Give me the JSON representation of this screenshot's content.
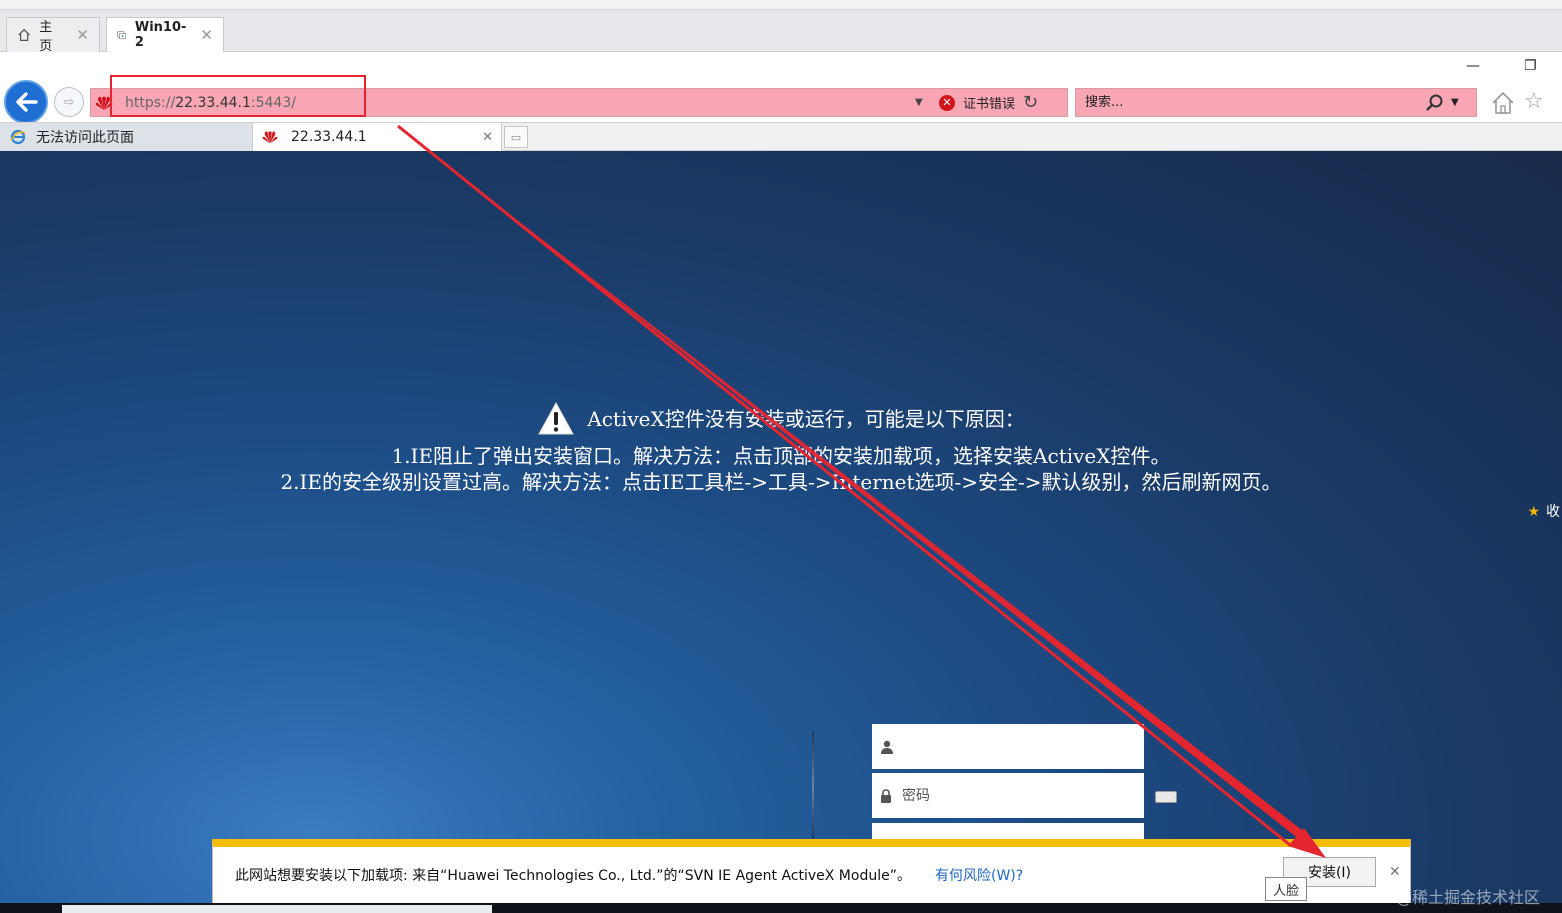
{
  "vm_tabs": [
    {
      "label": "主页",
      "icon": "home-icon"
    },
    {
      "label": "Win10-2",
      "icon": "vm-icon"
    }
  ],
  "address_bar": {
    "scheme": "https://",
    "host": "22.33.44.1",
    "rest": ":5443/",
    "cert_error": "证书错误"
  },
  "search": {
    "placeholder": "搜索..."
  },
  "tabs": [
    {
      "label": "无法访问此页面"
    },
    {
      "label": "22.33.44.1"
    }
  ],
  "page": {
    "warning_title": "ActiveX控件没有安装或运行，可能是以下原因：",
    "reason_1": "1.IE阻止了弹出安装窗口。解决方法：点击顶部的安装加载项，选择安装ActiveX控件。",
    "reason_2": "2.IE的安全级别设置过高。解决方法：点击IE工具栏->工具->Internet选项->安全->默认级别，然后刷新网页。",
    "fav_label": "收",
    "password_placeholder": "密码"
  },
  "notification": {
    "message": "此网站想要安装以下加载项: 来自“Huawei Technologies Co., Ltd.”的“SVN IE Agent ActiveX Module”。",
    "risk_link": "有何风险(W)?",
    "install_button": "安装(I)",
    "face_label": "人脸"
  },
  "watermark": "@稀土掘金技术社区",
  "colors": {
    "accent_back": "#1e6fd1",
    "address_error_bg": "#f8a6b3",
    "notify_stripe": "#f3bd0a",
    "annotation_red": "#e5252f"
  }
}
